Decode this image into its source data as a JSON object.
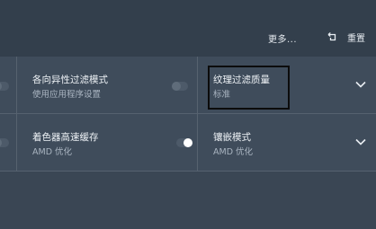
{
  "header": {
    "more_label": "更多...",
    "reset_label": "重置"
  },
  "settings": {
    "anisotropic": {
      "title": "各向异性过滤模式",
      "value": "使用应用程序设置",
      "toggle_on": false
    },
    "texture_quality": {
      "title": "纹理过滤质量",
      "value": "标准"
    },
    "shader_cache": {
      "title": "着色器高速缓存",
      "value": "AMD 优化",
      "toggle_on": true
    },
    "tessellation": {
      "title": "镶嵌模式",
      "value": "AMD 优化"
    }
  },
  "colors": {
    "accent_toggle_on": "#ffffff",
    "highlight_box": "#0c0c0c"
  },
  "icons": {
    "reset": "reset-icon",
    "chevron": "chevron-down-icon"
  }
}
